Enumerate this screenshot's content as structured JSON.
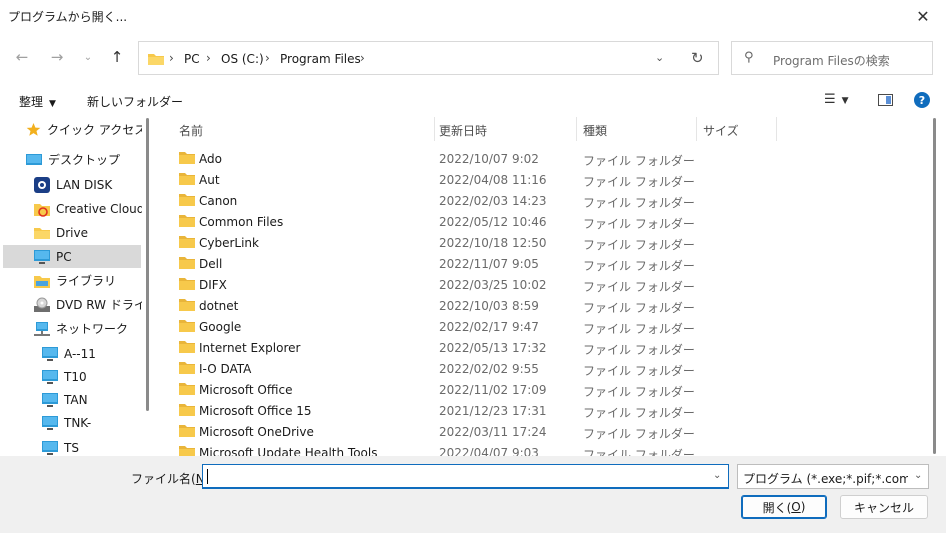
{
  "window": {
    "title": "プログラムから開く..."
  },
  "nav": {
    "back_icon": "back-arrow-icon",
    "forward_icon": "forward-arrow-icon",
    "recent_icon": "chevron-down-icon",
    "up_icon": "up-arrow-icon"
  },
  "address": {
    "crumbs": [
      "PC",
      "OS (C:)",
      "Program Files"
    ]
  },
  "search": {
    "placeholder": "Program Filesの検索"
  },
  "toolbar": {
    "organize_label": "整理",
    "new_folder_label": "新しいフォルダー"
  },
  "sidebar": {
    "items": [
      {
        "label": "クイック アクセス",
        "icon": "star-icon"
      },
      {
        "label": "デスクトップ",
        "icon": "desktop-icon"
      },
      {
        "label": "LAN DISK",
        "icon": "lan-disk-icon"
      },
      {
        "label": "Creative Cloud F",
        "icon": "creative-cloud-icon"
      },
      {
        "label": "Drive",
        "icon": "folder-icon"
      },
      {
        "label": "PC",
        "icon": "pc-icon",
        "selected": true
      },
      {
        "label": "ライブラリ",
        "icon": "library-icon"
      },
      {
        "label": "DVD RW ドライブ",
        "icon": "dvd-drive-icon"
      },
      {
        "label": "ネットワーク",
        "icon": "network-icon"
      },
      {
        "label": "A--11",
        "icon": "computer-icon"
      },
      {
        "label": "T10",
        "icon": "computer-icon"
      },
      {
        "label": "TAN",
        "icon": "computer-icon"
      },
      {
        "label": "TNK-",
        "icon": "computer-icon"
      },
      {
        "label": "TS",
        "icon": "computer-icon"
      }
    ]
  },
  "columns": {
    "name": "名前",
    "date": "更新日時",
    "type": "種類",
    "size": "サイズ"
  },
  "files": [
    {
      "name": "Ado",
      "date": "2022/10/07 9:02",
      "type": "ファイル フォルダー"
    },
    {
      "name": "Aut",
      "date": "2022/04/08 11:16",
      "type": "ファイル フォルダー"
    },
    {
      "name": "Canon",
      "date": "2022/02/03 14:23",
      "type": "ファイル フォルダー"
    },
    {
      "name": "Common Files",
      "date": "2022/05/12 10:46",
      "type": "ファイル フォルダー"
    },
    {
      "name": "CyberLink",
      "date": "2022/10/18 12:50",
      "type": "ファイル フォルダー"
    },
    {
      "name": "Dell",
      "date": "2022/11/07 9:05",
      "type": "ファイル フォルダー"
    },
    {
      "name": "DIFX",
      "date": "2022/03/25 10:02",
      "type": "ファイル フォルダー"
    },
    {
      "name": "dotnet",
      "date": "2022/10/03 8:59",
      "type": "ファイル フォルダー"
    },
    {
      "name": "Google",
      "date": "2022/02/17 9:47",
      "type": "ファイル フォルダー"
    },
    {
      "name": "Internet Explorer",
      "date": "2022/05/13 17:32",
      "type": "ファイル フォルダー"
    },
    {
      "name": "I-O DATA",
      "date": "2022/02/02 9:55",
      "type": "ファイル フォルダー"
    },
    {
      "name": "Microsoft Office",
      "date": "2022/11/02 17:09",
      "type": "ファイル フォルダー"
    },
    {
      "name": "Microsoft Office 15",
      "date": "2021/12/23 17:31",
      "type": "ファイル フォルダー"
    },
    {
      "name": "Microsoft OneDrive",
      "date": "2022/03/11 17:24",
      "type": "ファイル フォルダー"
    },
    {
      "name": "Microsoft Update Health Tools",
      "date": "2022/04/07 9:03",
      "type": "ファイル フォルダー"
    }
  ],
  "bottom": {
    "filename_label_pre": "ファイル名(",
    "filename_label_key": "N",
    "filename_label_post": "):",
    "filename_value": "",
    "filetype_value": "プログラム (*.exe;*.pif;*.com;*.bat",
    "open_label_pre": "開く(",
    "open_label_key": "O",
    "open_label_post": ")",
    "cancel_label": "キャンセル"
  },
  "colors": {
    "accent": "#0f6cbd",
    "folder": "#f7c94b",
    "selection": "#d9d9d9"
  }
}
